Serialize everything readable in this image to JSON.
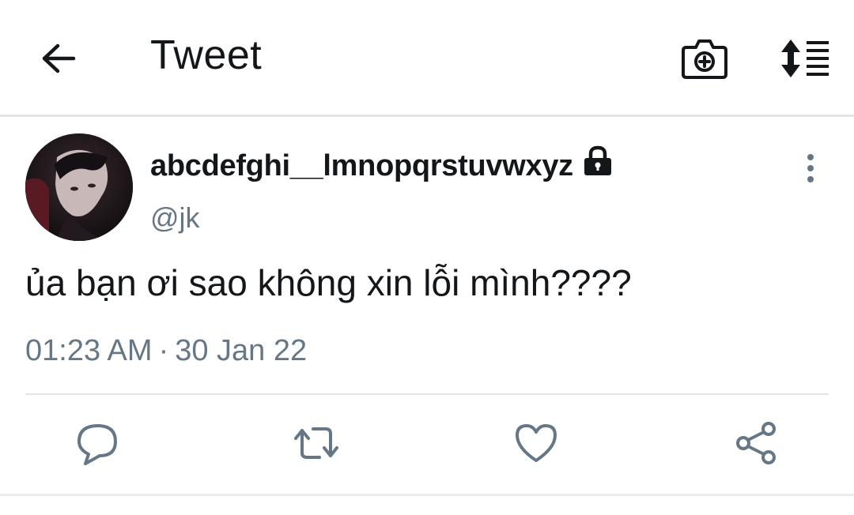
{
  "header": {
    "title": "Tweet",
    "back_icon": "arrow-left-icon",
    "camera_icon": "camera-plus-icon",
    "sort_icon": "sort-list-icon"
  },
  "tweet": {
    "display_name": "abcdefghi__lmnopqrstuvwxyz",
    "protected_icon": "lock-icon",
    "handle": "@jk",
    "text": "ủa bạn ơi sao không xin lỗi mình????",
    "time": "01:23 AM",
    "separator": "·",
    "date": "30 Jan 22",
    "more_icon": "more-vertical-icon"
  },
  "actions": {
    "reply_icon": "reply-icon",
    "retweet_icon": "retweet-icon",
    "like_icon": "heart-icon",
    "share_icon": "share-icon"
  },
  "colors": {
    "text_primary": "#14171a",
    "text_secondary": "#657786",
    "divider": "#e1e4e8"
  }
}
